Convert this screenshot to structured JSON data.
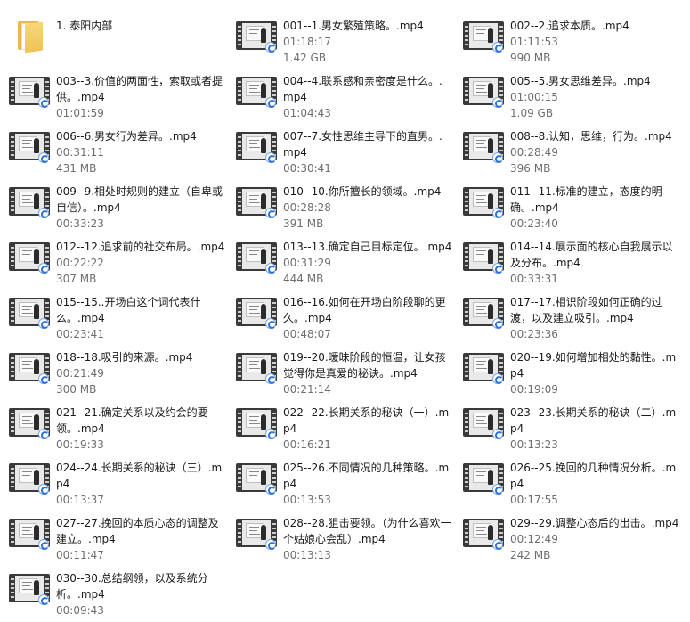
{
  "items": [
    {
      "type": "folder",
      "name": "1. 泰阳内部",
      "duration": "",
      "size": ""
    },
    {
      "type": "video",
      "name": "001--1.男女繁殖策略。.mp4",
      "duration": "01:18:17",
      "size": "1.42 GB"
    },
    {
      "type": "video",
      "name": "002--2.追求本质。.mp4",
      "duration": "01:11:53",
      "size": "990 MB"
    },
    {
      "type": "video",
      "name": "003--3.价值的两面性，索取或者提供。.mp4",
      "duration": "01:01:59",
      "size": ""
    },
    {
      "type": "video",
      "name": "004--4.联系感和亲密度是什么。.mp4",
      "duration": "01:04:43",
      "size": ""
    },
    {
      "type": "video",
      "name": "005--5.男女思维差异。.mp4",
      "duration": "01:00:15",
      "size": "1.09 GB"
    },
    {
      "type": "video",
      "name": "006--6.男女行为差异。.mp4",
      "duration": "00:31:11",
      "size": "431 MB"
    },
    {
      "type": "video",
      "name": "007--7.女性思维主导下的直男。.mp4",
      "duration": "00:30:41",
      "size": ""
    },
    {
      "type": "video",
      "name": "008--8.认知，思维，行为。.mp4",
      "duration": "00:28:49",
      "size": "396 MB"
    },
    {
      "type": "video",
      "name": "009--9.相处时规则的建立（自卑或自信）。.mp4",
      "duration": "00:33:23",
      "size": ""
    },
    {
      "type": "video",
      "name": "010--10.你所擅长的领域。.mp4",
      "duration": "00:28:28",
      "size": "391 MB"
    },
    {
      "type": "video",
      "name": "011--11.标准的建立，态度的明确。.mp4",
      "duration": "00:23:40",
      "size": ""
    },
    {
      "type": "video",
      "name": "012--12.追求前的社交布局。.mp4",
      "duration": "00:22:22",
      "size": "307 MB"
    },
    {
      "type": "video",
      "name": "013--13.确定自己目标定位。.mp4",
      "duration": "00:31:29",
      "size": "444 MB"
    },
    {
      "type": "video",
      "name": "014--14.展示面的核心自我展示以及分布。.mp4",
      "duration": "00:33:31",
      "size": ""
    },
    {
      "type": "video",
      "name": "015--15..开场白这个词代表什么。.mp4",
      "duration": "00:23:41",
      "size": ""
    },
    {
      "type": "video",
      "name": "016--16.如何在开场白阶段聊的更久。.mp4",
      "duration": "00:48:07",
      "size": ""
    },
    {
      "type": "video",
      "name": "017--17.相识阶段如何正确的过渡，以及建立吸引。.mp4",
      "duration": "00:23:36",
      "size": ""
    },
    {
      "type": "video",
      "name": "018--18.吸引的来源。.mp4",
      "duration": "00:21:49",
      "size": "300 MB"
    },
    {
      "type": "video",
      "name": "019--20.暧昧阶段的恒温，让女孩觉得你是真爱的秘诀。.mp4",
      "duration": "00:21:14",
      "size": ""
    },
    {
      "type": "video",
      "name": "020--19.如何增加相处的黏性。.mp4",
      "duration": "00:19:09",
      "size": ""
    },
    {
      "type": "video",
      "name": "021--21.确定关系以及约会的要领。.mp4",
      "duration": "00:19:33",
      "size": ""
    },
    {
      "type": "video",
      "name": "022--22.长期关系的秘诀（一）.mp4",
      "duration": "00:16:21",
      "size": ""
    },
    {
      "type": "video",
      "name": "023--23.长期关系的秘诀（二）.mp4",
      "duration": "00:13:23",
      "size": ""
    },
    {
      "type": "video",
      "name": "024--24.长期关系的秘诀（三）.mp4",
      "duration": "00:13:37",
      "size": ""
    },
    {
      "type": "video",
      "name": "025--26.不同情况的几种策略。.mp4",
      "duration": "00:13:53",
      "size": ""
    },
    {
      "type": "video",
      "name": "026--25.挽回的几种情况分析。.mp4",
      "duration": "00:17:55",
      "size": ""
    },
    {
      "type": "video",
      "name": "027--27.挽回的本质心态的调整及建立。.mp4",
      "duration": "00:11:47",
      "size": ""
    },
    {
      "type": "video",
      "name": "028--28.狙击要领。（为什么喜欢一个姑娘心会乱）.mp4",
      "duration": "00:13:13",
      "size": ""
    },
    {
      "type": "video",
      "name": "029--29.调整心态后的出击。.mp4",
      "duration": "00:12:49",
      "size": "242 MB"
    },
    {
      "type": "video",
      "name": "030--30.总结纲领，以及系统分析。.mp4",
      "duration": "00:09:43",
      "size": ""
    }
  ]
}
